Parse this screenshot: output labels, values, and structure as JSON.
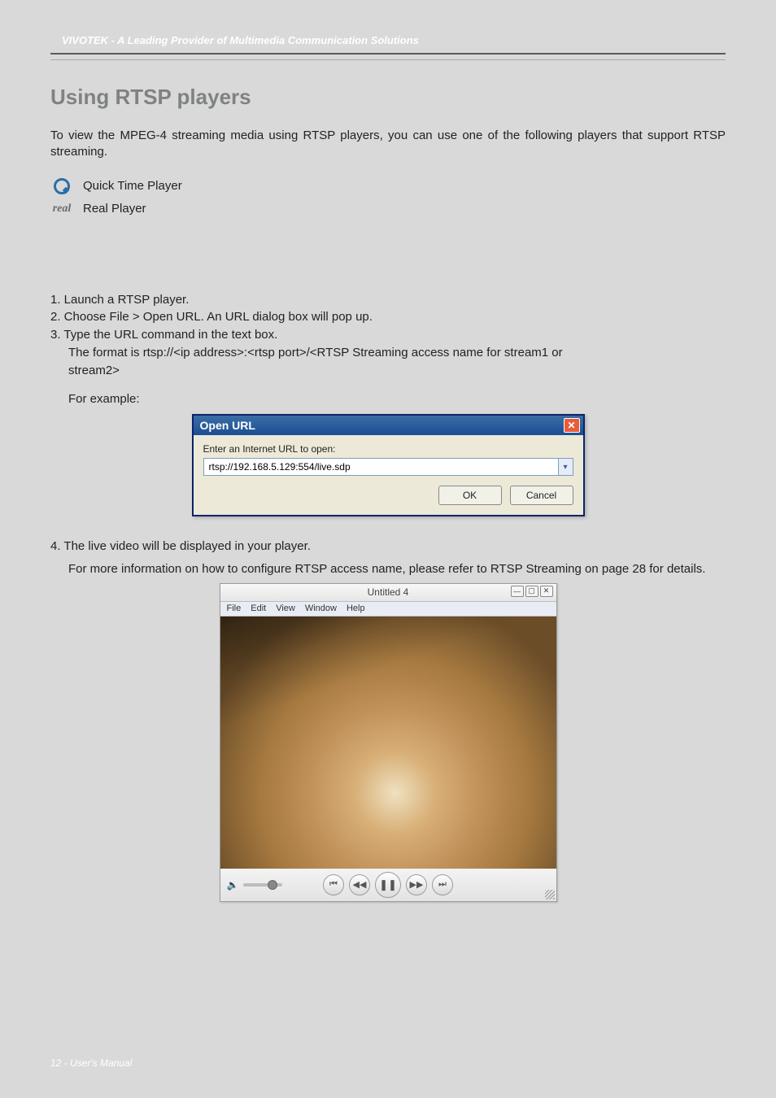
{
  "header": {
    "breadcrumb": "VIVOTEK - A Leading Provider of Multimedia Communication Solutions"
  },
  "section": {
    "title": "Using RTSP players",
    "intro": "To view the MPEG-4 streaming media using RTSP players, you can use one of the following players that support RTSP streaming."
  },
  "players": [
    {
      "icon": "quicktime-icon",
      "label": "Quick Time Player"
    },
    {
      "icon": "realplayer-icon",
      "label": "Real Player"
    }
  ],
  "steps": {
    "s1": "1. Launch a RTSP player.",
    "s2": "2. Choose File > Open URL. An URL dialog box will pop up.",
    "s3": "3. Type the URL command in the text box.",
    "s3_detail_a": "The format is rtsp://<ip address>:<rtsp port>/<RTSP Streaming access name for stream1 or",
    "s3_detail_b": "stream2>",
    "example_label": "For example:"
  },
  "open_url_dialog": {
    "title": "Open URL",
    "label": "Enter an Internet URL to open:",
    "value": "rtsp://192.168.5.129:554/live.sdp",
    "ok": "OK",
    "cancel": "Cancel"
  },
  "step4": {
    "line": "4. The live video will be displayed in your player.",
    "detail": "For more information on how to configure RTSP access name, please refer to RTSP Streaming on page 28 for details."
  },
  "video_player": {
    "title": "Untitled 4",
    "menu": [
      "File",
      "Edit",
      "View",
      "Window",
      "Help"
    ]
  },
  "footer": {
    "text": "12 - User's Manual"
  }
}
